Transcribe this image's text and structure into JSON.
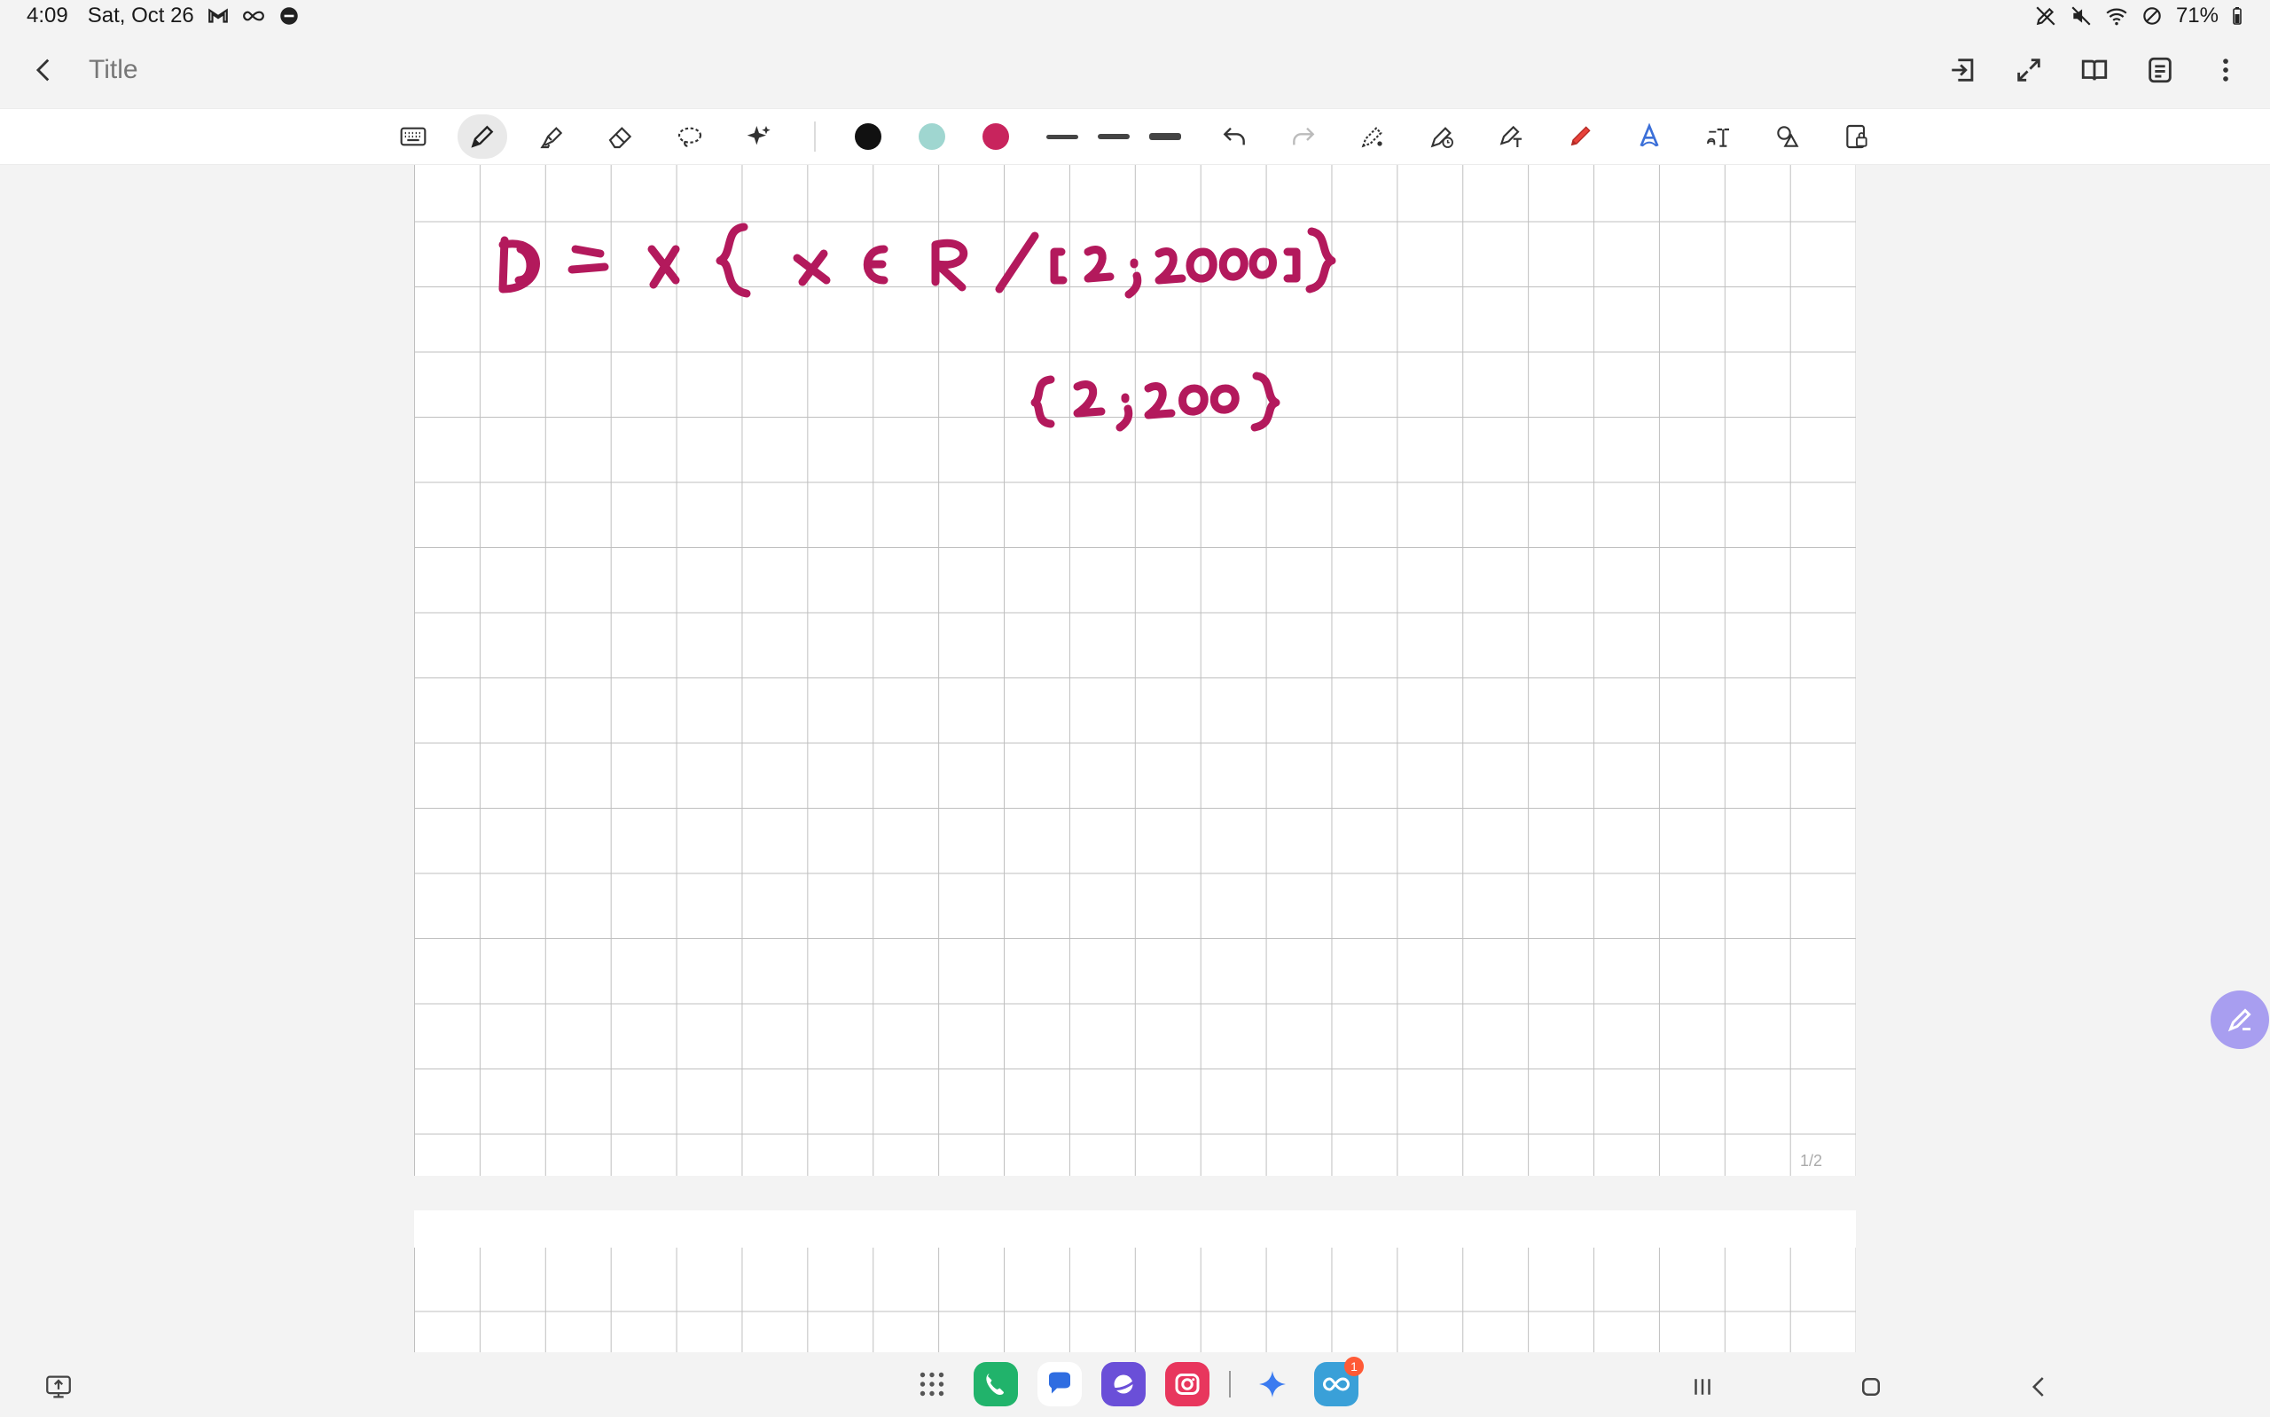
{
  "status_bar": {
    "time": "4:09",
    "date": "Sat, Oct 26",
    "battery": "71%"
  },
  "header": {
    "title": "Title"
  },
  "toolbar": {
    "tools": [
      "keyboard-icon",
      "pen-icon",
      "highlighter-icon",
      "eraser-icon",
      "lasso-icon",
      "ai-assist-icon"
    ],
    "colors": [
      "#111111",
      "#9fd6d0",
      "#c8245d"
    ],
    "active_color": "#c8245d"
  },
  "canvas": {
    "ink_color": "#b3195c",
    "line1": "D = x {x ∈ R / [2 ; 2000] }",
    "line2": "{2 ; 200 }",
    "page_number": "1/2"
  },
  "taskbar": {
    "phone_badge": "1"
  }
}
